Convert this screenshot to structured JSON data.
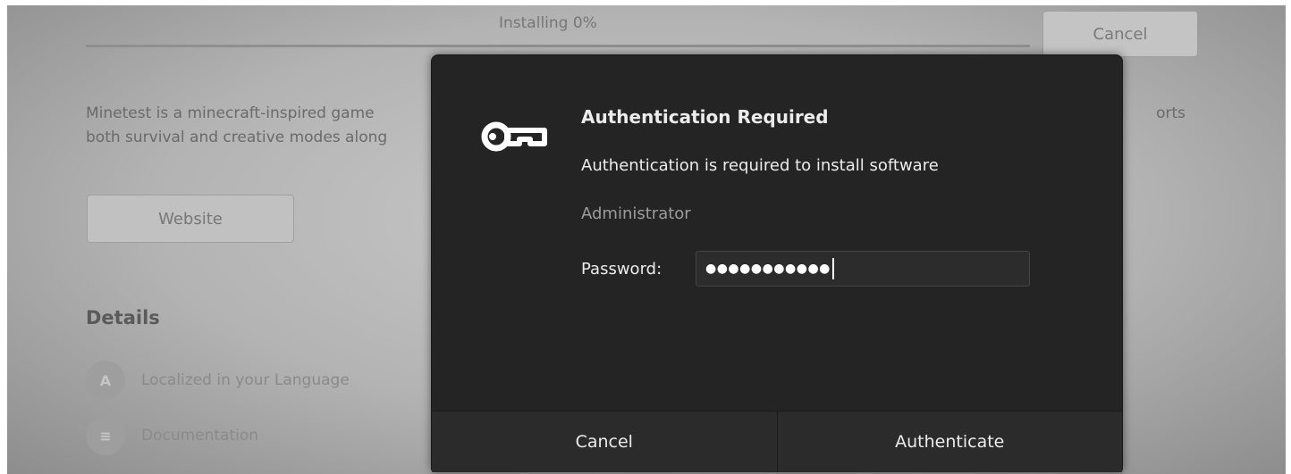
{
  "background": {
    "progress_label": "Installing 0%",
    "progress_fraction": 0,
    "cancel_label": "Cancel",
    "description_line1": "Minetest is a minecraft-inspired game",
    "description_line1_tail": "orts",
    "description_line2": "both survival and creative modes along",
    "website_label": "Website",
    "details_heading": "Details",
    "details": [
      {
        "label": "Localized in your Language",
        "icon": "language-icon"
      },
      {
        "label": "Documentation",
        "icon": "documentation-icon"
      }
    ]
  },
  "dialog": {
    "icon": "key-icon",
    "title": "Authentication Required",
    "message": "Authentication is required to install software",
    "user": "Administrator",
    "password_label": "Password:",
    "password_value": "●●●●●●●●●●●",
    "cancel_label": "Cancel",
    "authenticate_label": "Authenticate"
  },
  "colors": {
    "dialog_bg": "#242424",
    "dialog_text": "#ececec",
    "dim_text": "#9c9c9c"
  }
}
